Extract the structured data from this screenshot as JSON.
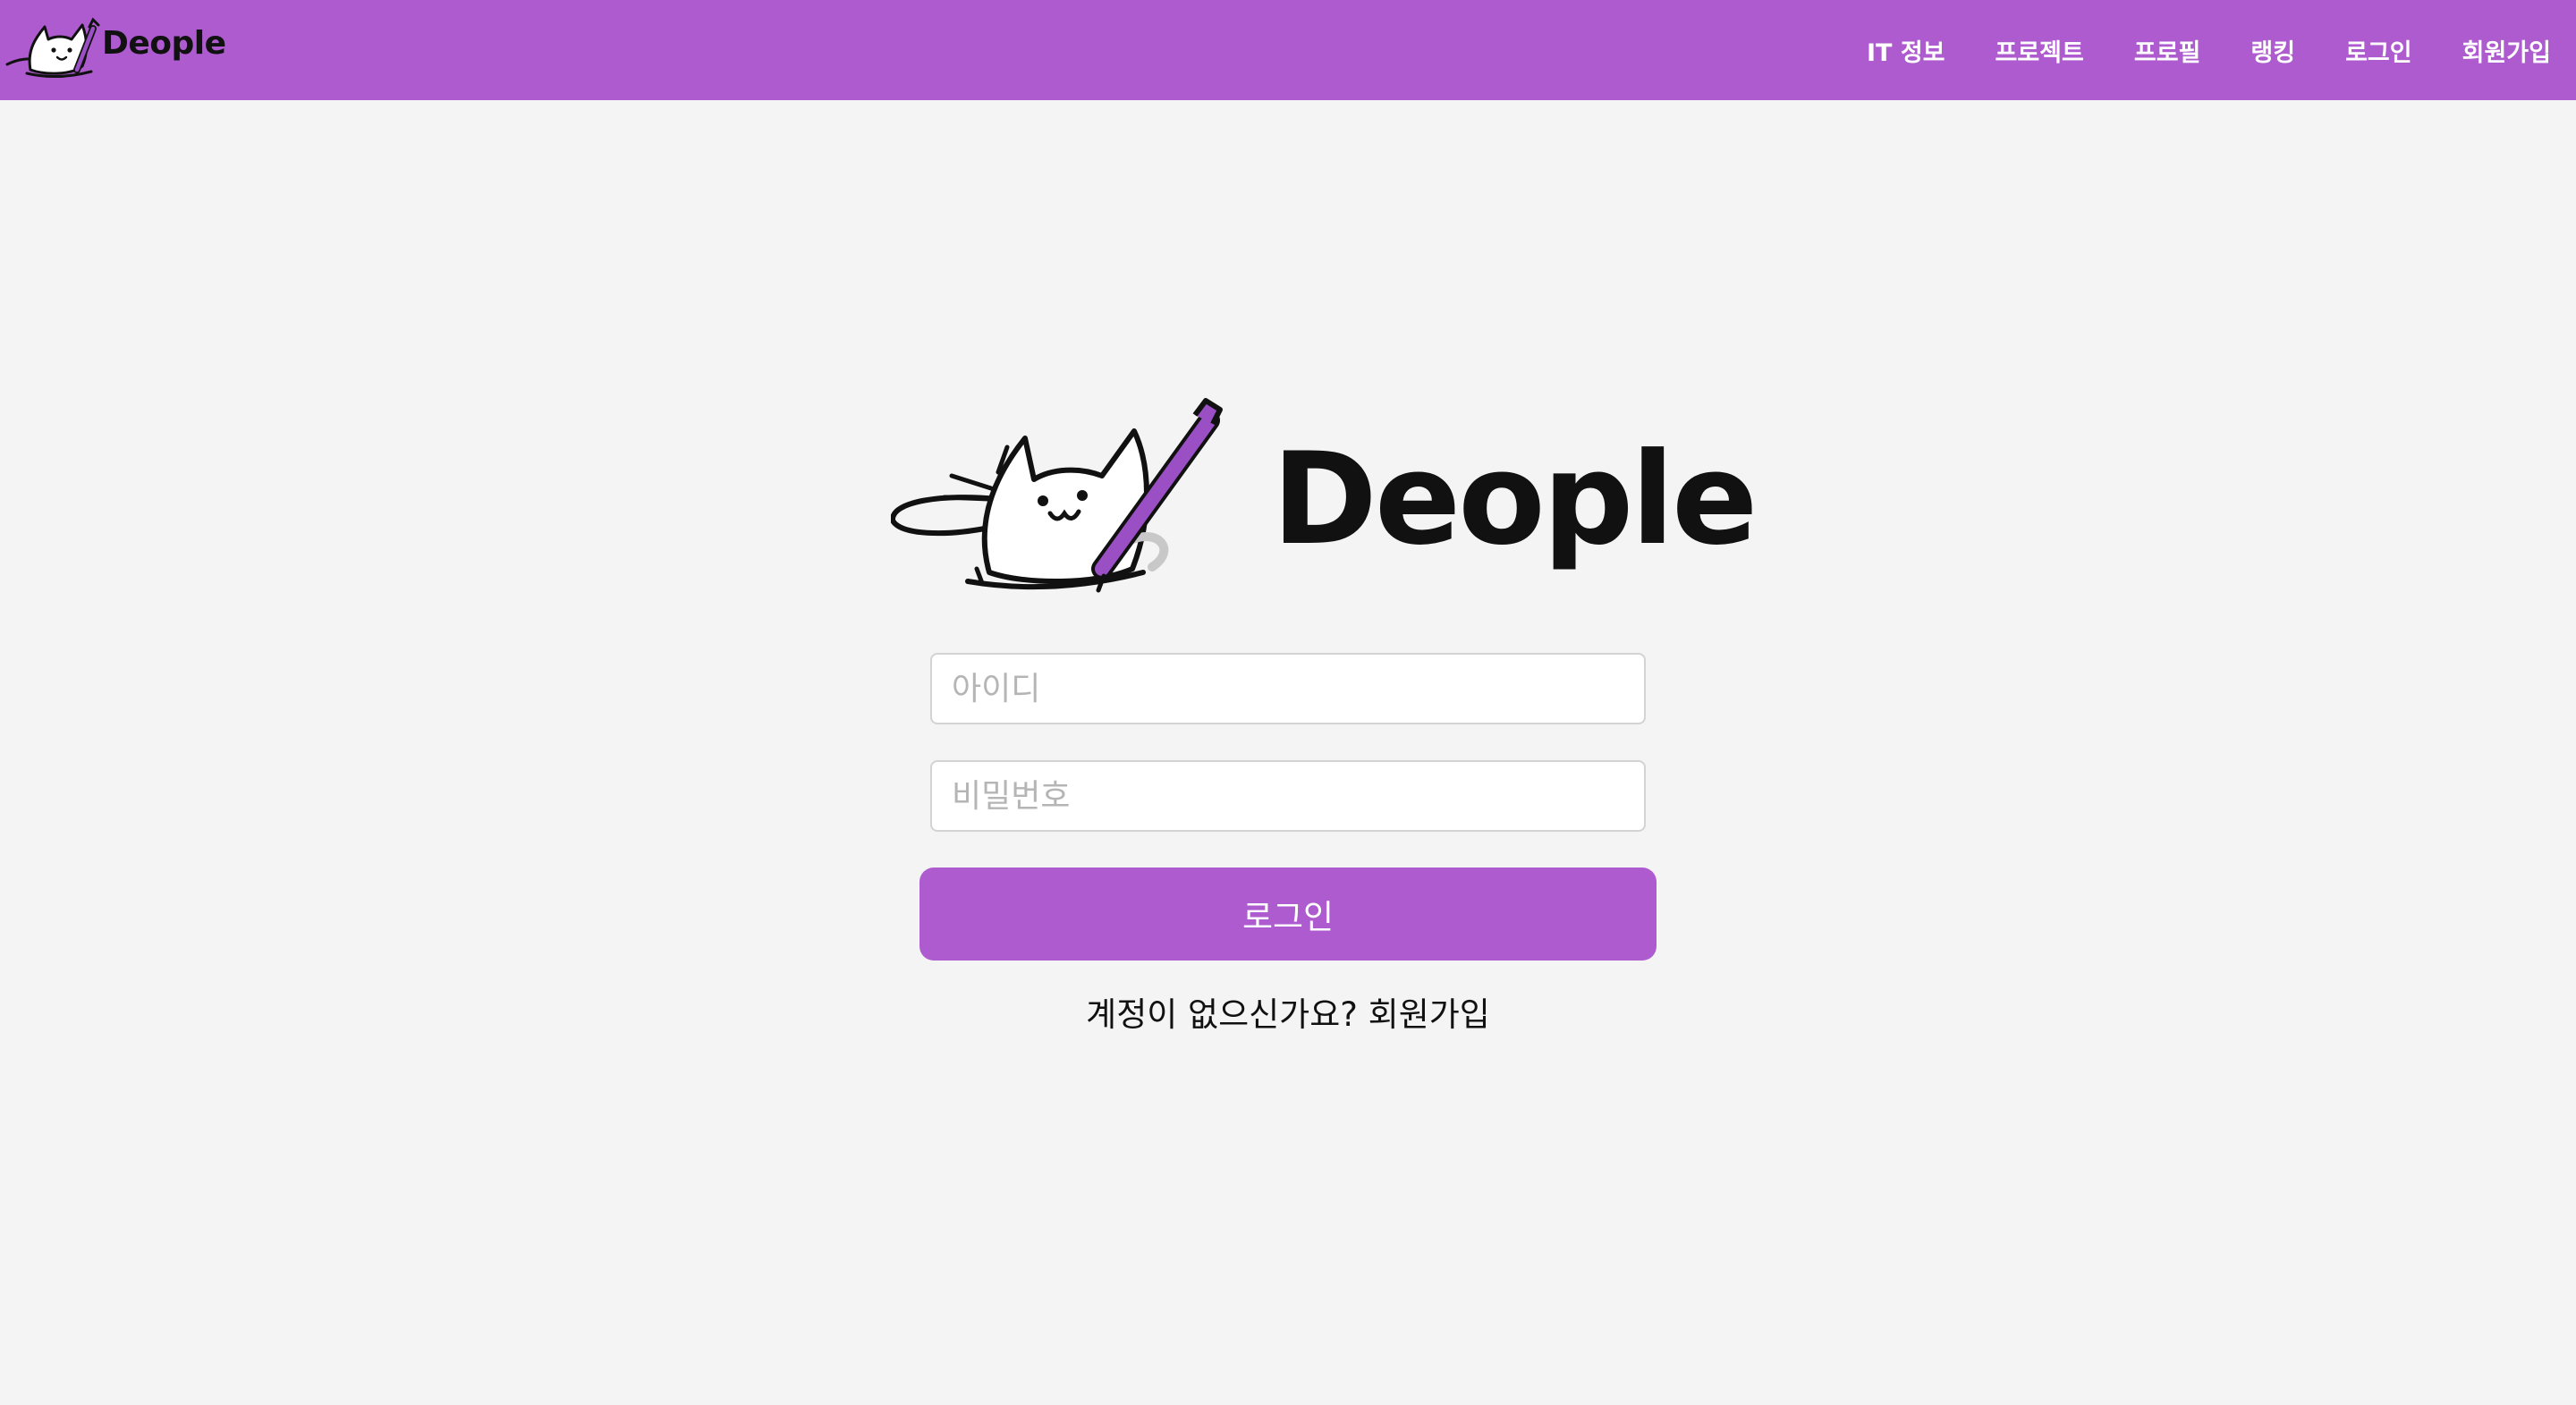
{
  "header": {
    "logo_text": "Deople",
    "nav": [
      {
        "label": "IT 정보"
      },
      {
        "label": "프로젝트"
      },
      {
        "label": "프로필"
      },
      {
        "label": "랭킹"
      },
      {
        "label": "로그인"
      },
      {
        "label": "회원가입"
      }
    ]
  },
  "main": {
    "logo_text": "Deople",
    "username_placeholder": "아이디",
    "password_placeholder": "비밀번호",
    "login_button": "로그인",
    "signup_prompt": "계정이 없으신가요?",
    "signup_link": "회원가입"
  },
  "colors": {
    "accent": "#ad5bcf",
    "background": "#f4f4f4"
  },
  "icons": [
    "cat-logo-icon"
  ]
}
